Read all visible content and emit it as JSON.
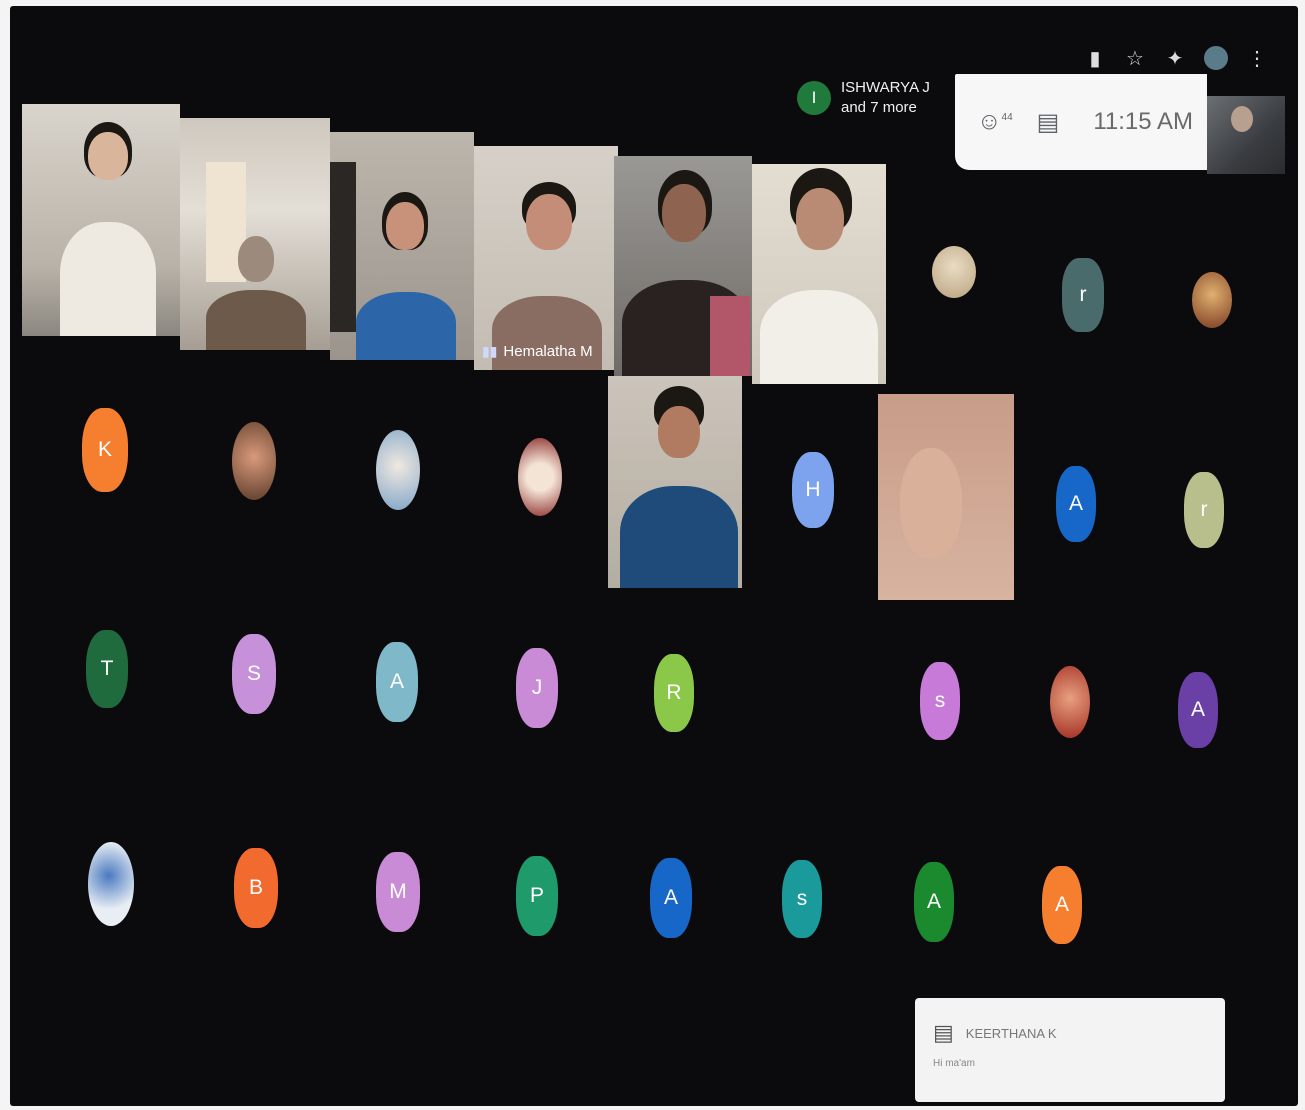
{
  "browser": {
    "icons": [
      "cast-icon",
      "star-icon",
      "extensions-icon",
      "profile-icon",
      "menu-icon"
    ]
  },
  "presenter": {
    "initial": "I",
    "name": "ISHWARYA J",
    "more": "and 7 more"
  },
  "info_panel": {
    "people_count_icon": "people-icon",
    "chat_icon": "chat-icon",
    "time": "11:15 AM"
  },
  "video_tiles": [
    {
      "name": "",
      "speaking": false
    },
    {
      "name": "",
      "speaking": false
    },
    {
      "name": "",
      "speaking": false
    },
    {
      "name": "Hemalatha M",
      "speaking": true
    },
    {
      "name": "",
      "speaking": false
    },
    {
      "name": "",
      "speaking": false
    },
    {
      "name": "",
      "speaking": false
    },
    {
      "name": "",
      "speaking": false
    }
  ],
  "avatars": [
    {
      "initial": "",
      "color": "#c9b79a",
      "photo": true
    },
    {
      "initial": "r",
      "color": "#4a6b6c"
    },
    {
      "initial": "",
      "color": "#a0522d",
      "photo": true
    },
    {
      "initial": "K",
      "color": "#f57f2f"
    },
    {
      "initial": "",
      "color": "#8a5a4a",
      "photo": true
    },
    {
      "initial": "",
      "color": "#9fb3c8",
      "photo": true
    },
    {
      "initial": "",
      "color": "#b04040",
      "photo": true
    },
    {
      "initial": "H",
      "color": "#7da3ef"
    },
    {
      "initial": "A",
      "color": "#1767c9"
    },
    {
      "initial": "r",
      "color": "#b8bf8d"
    },
    {
      "initial": "T",
      "color": "#1f6b3e"
    },
    {
      "initial": "S",
      "color": "#c691d9"
    },
    {
      "initial": "A",
      "color": "#7fb8c8"
    },
    {
      "initial": "J",
      "color": "#c98ad6"
    },
    {
      "initial": "R",
      "color": "#8bc84a"
    },
    {
      "initial": "s",
      "color": "#c77ad8"
    },
    {
      "initial": "",
      "color": "#d04a2a",
      "photo": true
    },
    {
      "initial": "A",
      "color": "#6a3fa6"
    },
    {
      "initial": "",
      "color": "#b9c9e6",
      "photo": true
    },
    {
      "initial": "B",
      "color": "#f26a2e"
    },
    {
      "initial": "M",
      "color": "#c98ad6"
    },
    {
      "initial": "P",
      "color": "#1f9a6a"
    },
    {
      "initial": "A",
      "color": "#1767c9"
    },
    {
      "initial": "s",
      "color": "#1a9a9a"
    },
    {
      "initial": "A",
      "color": "#1b8a2f"
    },
    {
      "initial": "A",
      "color": "#f57f2f"
    }
  ],
  "chat_notification": {
    "sender": "KEERTHANA K",
    "message": "Hi ma'am"
  }
}
